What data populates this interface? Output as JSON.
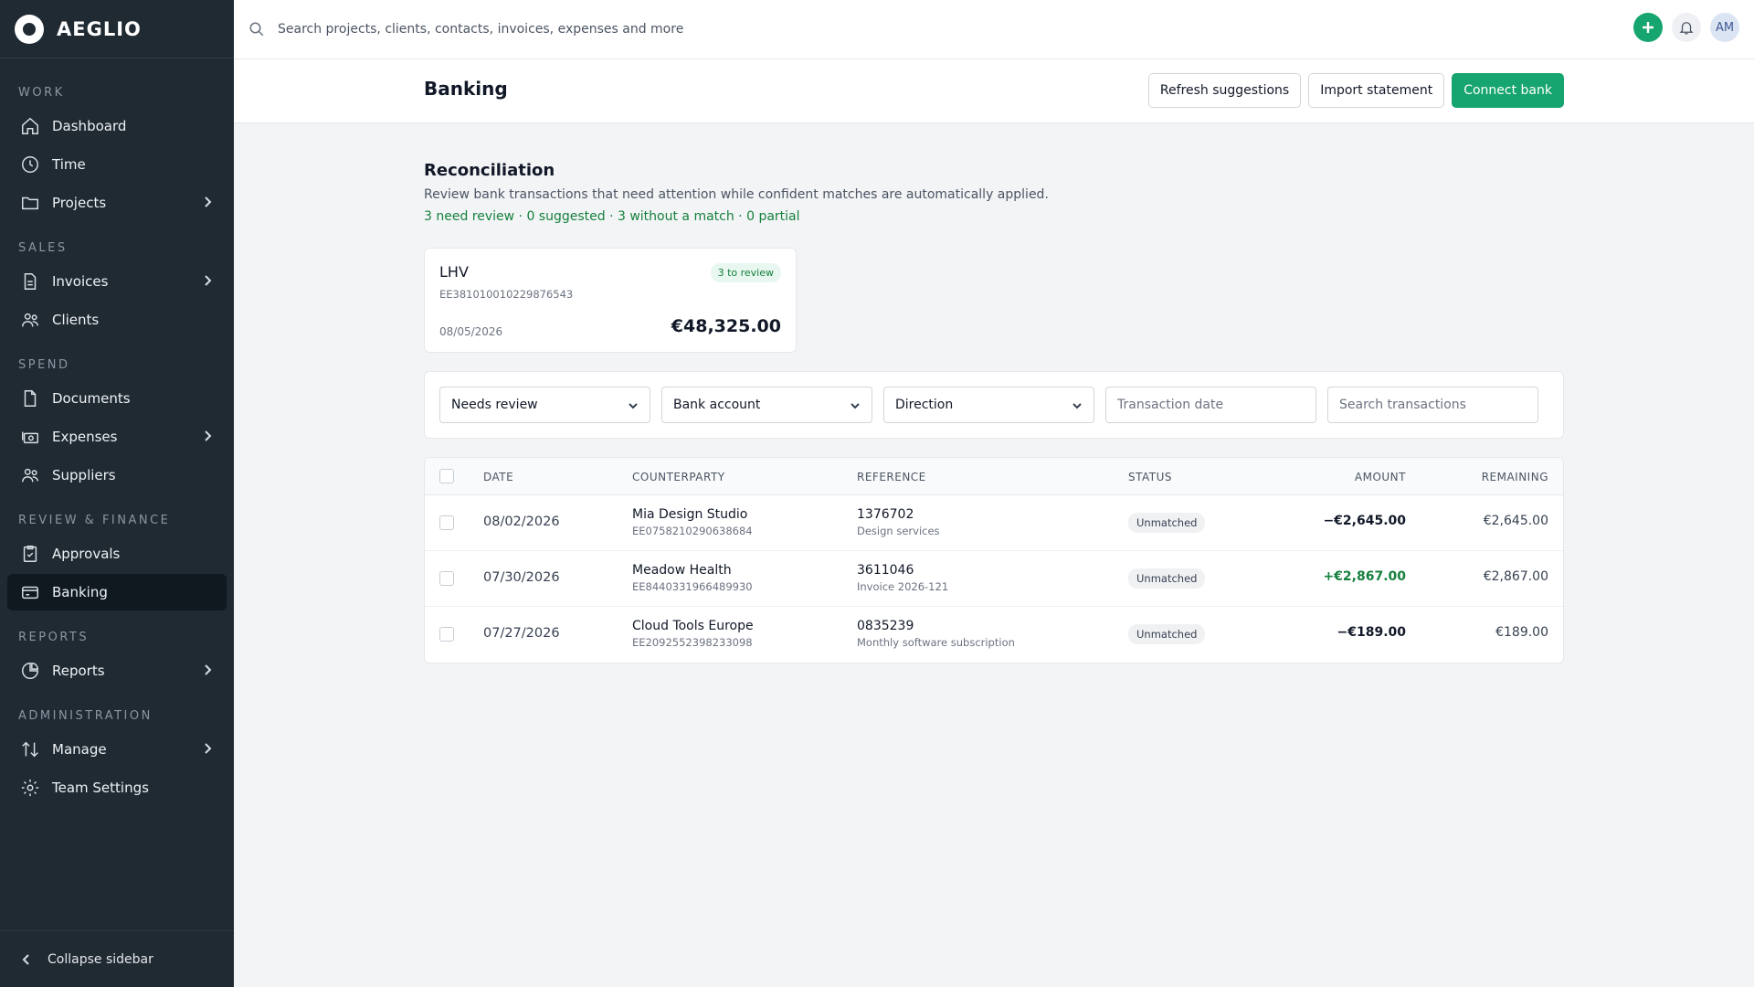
{
  "app": {
    "name": "AEGLIO"
  },
  "search": {
    "placeholder": "Search projects, clients, contacts, invoices, expenses and more"
  },
  "user": {
    "initials": "AM"
  },
  "sidebar": {
    "sections": [
      {
        "title": "WORK",
        "items": [
          {
            "label": "Dashboard",
            "icon": "home-icon"
          },
          {
            "label": "Time",
            "icon": "clock-icon"
          },
          {
            "label": "Projects",
            "icon": "folder-icon",
            "expandable": true
          }
        ]
      },
      {
        "title": "SALES",
        "items": [
          {
            "label": "Invoices",
            "icon": "document-icon",
            "expandable": true
          },
          {
            "label": "Clients",
            "icon": "users-icon"
          }
        ]
      },
      {
        "title": "SPEND",
        "items": [
          {
            "label": "Documents",
            "icon": "file-icon"
          },
          {
            "label": "Expenses",
            "icon": "cash-icon",
            "expandable": true
          },
          {
            "label": "Suppliers",
            "icon": "users-icon"
          }
        ]
      },
      {
        "title": "REVIEW & FINANCE",
        "items": [
          {
            "label": "Approvals",
            "icon": "clipboard-check-icon"
          },
          {
            "label": "Banking",
            "icon": "credit-card-icon",
            "active": true
          }
        ]
      },
      {
        "title": "REPORTS",
        "items": [
          {
            "label": "Reports",
            "icon": "pie-chart-icon",
            "expandable": true
          }
        ]
      },
      {
        "title": "ADMINISTRATION",
        "items": [
          {
            "label": "Manage",
            "icon": "arrows-icon",
            "expandable": true
          },
          {
            "label": "Team Settings",
            "icon": "gear-icon"
          }
        ]
      }
    ],
    "collapse_label": "Collapse sidebar"
  },
  "page": {
    "title": "Banking",
    "buttons": {
      "refresh": "Refresh suggestions",
      "import": "Import statement",
      "connect": "Connect bank"
    }
  },
  "reconciliation": {
    "title": "Reconciliation",
    "description": "Review bank transactions that need attention while confident matches are automatically applied.",
    "stats": "3 need review · 0 suggested · 3 without a match · 0 partial"
  },
  "account": {
    "name": "LHV",
    "iban": "EE381010010229876543",
    "badge": "3 to review",
    "date": "08/05/2026",
    "balance": "€48,325.00"
  },
  "filters": {
    "status": "Needs review",
    "account": "Bank account",
    "direction": "Direction",
    "date_placeholder": "Transaction date",
    "search_placeholder": "Search transactions"
  },
  "table": {
    "headers": {
      "date": "DATE",
      "counterparty": "COUNTERPARTY",
      "reference": "REFERENCE",
      "status": "STATUS",
      "amount": "AMOUNT",
      "remaining": "REMAINING"
    },
    "rows": [
      {
        "date": "08/02/2026",
        "counterparty": "Mia Design Studio",
        "iban": "EE075821029063868​4",
        "reference": "1376702",
        "reference_note": "Design services",
        "status": "Unmatched",
        "amount": "−€2,645.00",
        "direction": "out",
        "remaining": "€2,645.00"
      },
      {
        "date": "07/30/2026",
        "counterparty": "Meadow Health",
        "iban": "EE844033196648993​0",
        "reference": "3611046",
        "reference_note": "Invoice 2026-121",
        "status": "Unmatched",
        "amount": "+€2,867.00",
        "direction": "in",
        "remaining": "€2,867.00"
      },
      {
        "date": "07/27/2026",
        "counterparty": "Cloud Tools Europe",
        "iban": "EE209255239823309​8",
        "reference": "0835239",
        "reference_note": "Monthly software subscription",
        "status": "Unmatched",
        "amount": "−€189.00",
        "direction": "out",
        "remaining": "€189.00"
      }
    ]
  }
}
